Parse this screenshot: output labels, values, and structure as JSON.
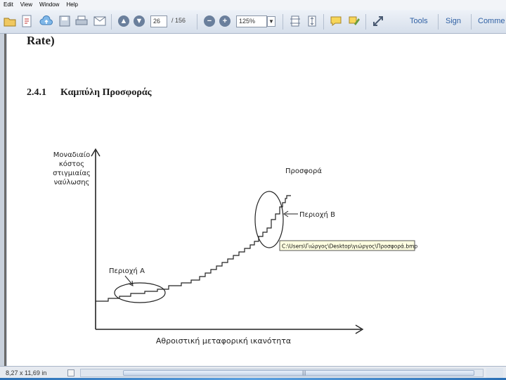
{
  "menu": [
    "Edit",
    "View",
    "Window",
    "Help"
  ],
  "toolbar": {
    "page_current": "26",
    "page_total": "/ 156",
    "zoom": "125%",
    "tools_label": "Tools",
    "sign_label": "Sign",
    "comment_label": "Comme"
  },
  "document": {
    "top_fragment": "Rate)",
    "section_number": "2.4.1",
    "section_title": "Καμπύλη Προσφοράς"
  },
  "figure": {
    "y_axis_label": [
      "Μοναδιαίο",
      "κόστος",
      "στιγμιαίας",
      "ναύλωσης"
    ],
    "x_axis_label": "Αθροιστική μεταφορική ικανότητα",
    "curve_label": "Προσφορά",
    "region_a": "Περιοχή Α",
    "region_b": "Περιοχή Β",
    "tooltip": "C:\\Users\\Γιώργος\\Desktop\\γιώργος\\Προσφορά.bmp"
  },
  "status": {
    "page_size": "8,27 x 11,69 in"
  },
  "colors": {
    "toolbar_label": "#2e5fa3",
    "tooltip_bg": "#ffffe1"
  }
}
